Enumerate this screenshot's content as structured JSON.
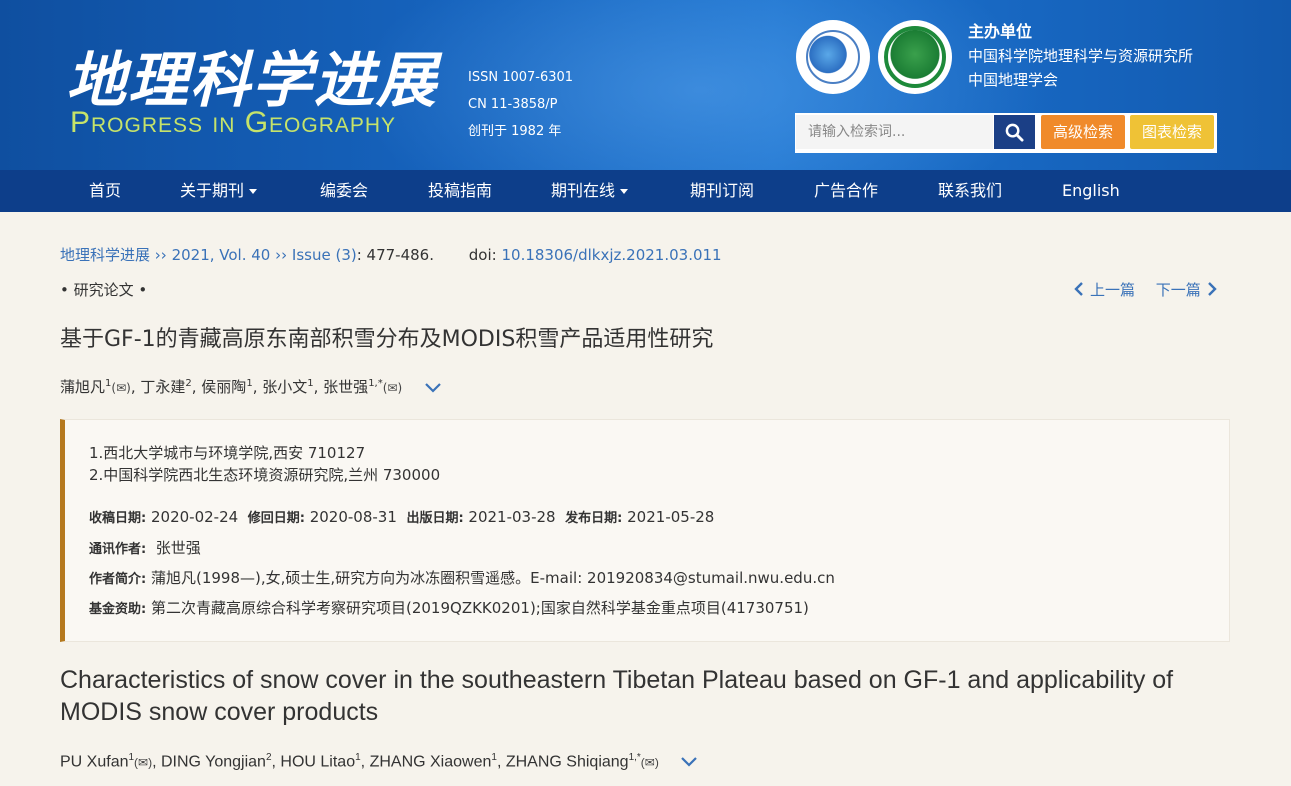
{
  "header": {
    "logo_cn": "地理科学进展",
    "logo_en": "Progress in Geography",
    "issn": "ISSN 1007-6301",
    "cn": "CN    11-3858/P",
    "founded": "创刊于  1982  年",
    "sponsor_title": "主办单位",
    "sponsor_1": "中国科学院地理科学与资源研究所",
    "sponsor_2": "中国地理学会",
    "search_placeholder": "请输入检索词...",
    "advanced_search": "高级检索",
    "chart_search": "图表检索"
  },
  "nav": {
    "items": [
      "首页",
      "关于期刊",
      "编委会",
      "投稿指南",
      "期刊在线",
      "期刊订阅",
      "广告合作",
      "联系我们",
      "English"
    ]
  },
  "breadcrumb": {
    "journal": "地理科学进展",
    "sep": "››",
    "volume": "2021, Vol. 40",
    "issue": "Issue (3)",
    "pages": ": 477-486.",
    "doi_label": "doi:",
    "doi": "10.18306/dlkxjz.2021.03.011"
  },
  "article": {
    "category": "• 研究论文 •",
    "prev": "上一篇",
    "next": "下一篇",
    "title_cn": "基于GF-1的青藏高原东南部积雪分布及MODIS积雪产品适用性研究",
    "authors_cn": [
      {
        "name": "蒲旭凡",
        "sup": "1",
        "mail": "(✉)"
      },
      {
        "name": "丁永建",
        "sup": "2",
        "mail": ""
      },
      {
        "name": "侯丽陶",
        "sup": "1",
        "mail": ""
      },
      {
        "name": "张小文",
        "sup": "1",
        "mail": ""
      },
      {
        "name": "张世强",
        "sup": "1,*",
        "mail": "(✉)"
      }
    ],
    "affiliations": [
      "1.西北大学城市与环境学院,西安 710127",
      "2.中国科学院西北生态环境资源研究院,兰州 730000"
    ],
    "dates": {
      "received_label": "收稿日期:",
      "received": "2020-02-24",
      "revised_label": "修回日期:",
      "revised": "2020-08-31",
      "online_label": "出版日期:",
      "online": "2021-03-28",
      "published_label": "发布日期:",
      "published": "2021-05-28"
    },
    "corresponding_label": "通讯作者:",
    "corresponding": "张世强",
    "bio_label": "作者简介:",
    "bio": "蒲旭凡(1998—),女,硕士生,研究方向为冰冻圈积雪遥感。E-mail: 201920834@stumail.nwu.edu.cn",
    "funding_label": "基金资助:",
    "funding": "第二次青藏高原综合科学考察研究项目(2019QZKK0201);国家自然科学基金重点项目(41730751)",
    "title_en": "Characteristics of snow cover in the southeastern Tibetan Plateau based on GF-1 and applicability of MODIS snow cover products",
    "authors_en": [
      {
        "name": "PU Xufan",
        "sup": "1",
        "mail": "(✉)"
      },
      {
        "name": "DING Yongjian",
        "sup": "2",
        "mail": ""
      },
      {
        "name": "HOU Litao",
        "sup": "1",
        "mail": ""
      },
      {
        "name": "ZHANG Xiaowen",
        "sup": "1",
        "mail": ""
      },
      {
        "name": "ZHANG Shiqiang",
        "sup": "1,*",
        "mail": "(✉)"
      }
    ]
  },
  "colors": {
    "header_blue": "#1663bd",
    "nav_blue": "#0d3e8a",
    "link": "#3a72b8",
    "accent_bar": "#b5791e",
    "logo_green": "#c6e36a"
  },
  "icons": {
    "search": "search-icon",
    "prev": "chevron-left-icon",
    "next": "chevron-right-icon",
    "expand": "chevron-down-icon",
    "mail": "mail-icon"
  }
}
